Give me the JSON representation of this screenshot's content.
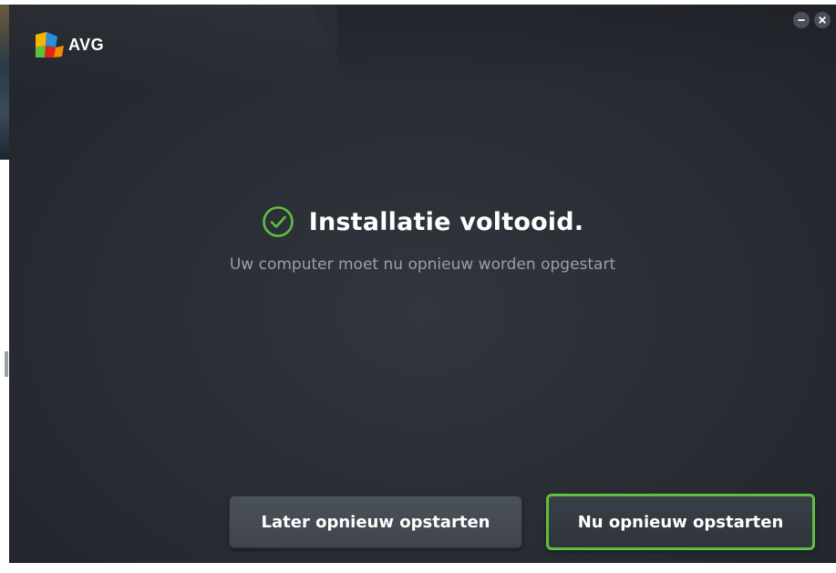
{
  "app": {
    "logo_text": "AVG",
    "brand_colors": [
      "#f7b500",
      "#e2231a",
      "#2a8fd8",
      "#5fbf3f"
    ]
  },
  "window_controls": {
    "minimize_icon": "minimize-icon",
    "close_icon": "close-icon"
  },
  "status": {
    "icon": "check-circle-icon",
    "icon_color": "#5fbf3f",
    "title": "Installatie voltooid.",
    "subtitle": "Uw computer moet nu opnieuw worden opgestart"
  },
  "actions": {
    "later_label": "Later opnieuw opstarten",
    "now_label": "Nu opnieuw opstarten",
    "now_accent": "#5fbf3f"
  }
}
